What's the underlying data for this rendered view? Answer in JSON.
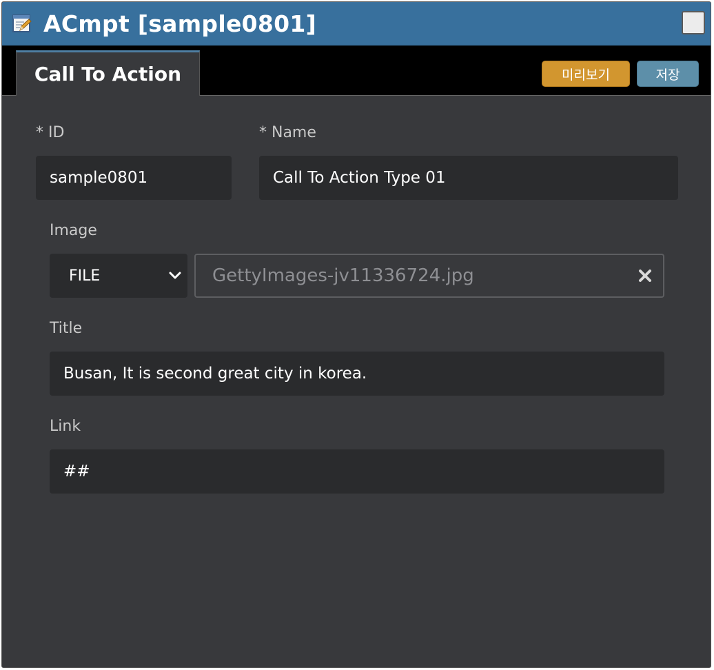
{
  "window": {
    "title": "ACmpt [sample0801]",
    "app_icon": "edit-document-icon",
    "maximize_icon": "maximize-box-icon"
  },
  "tabs": [
    {
      "label": "Call To Action",
      "active": true
    }
  ],
  "toolbar": {
    "preview_label": "미리보기",
    "save_label": "저장",
    "preview_color": "#d2962f",
    "save_color": "#5d8fa9"
  },
  "form": {
    "id": {
      "label": "* ID",
      "value": "sample0801"
    },
    "name": {
      "label": "* Name",
      "value": "Call To Action Type 01"
    },
    "image": {
      "label": "Image",
      "type_selected": "FILE",
      "file_name": "GettyImages-jv11336724.jpg",
      "chevron_icon": "chevron-down-icon",
      "clear_icon": "close-icon"
    },
    "title": {
      "label": "Title",
      "value": "Busan, It is second great city in korea."
    },
    "link": {
      "label": "Link",
      "value": "##"
    }
  },
  "colors": {
    "titlebar": "#38709d",
    "panel": "#38393c",
    "field": "#2a2b2d",
    "tabbar": "#000000"
  }
}
